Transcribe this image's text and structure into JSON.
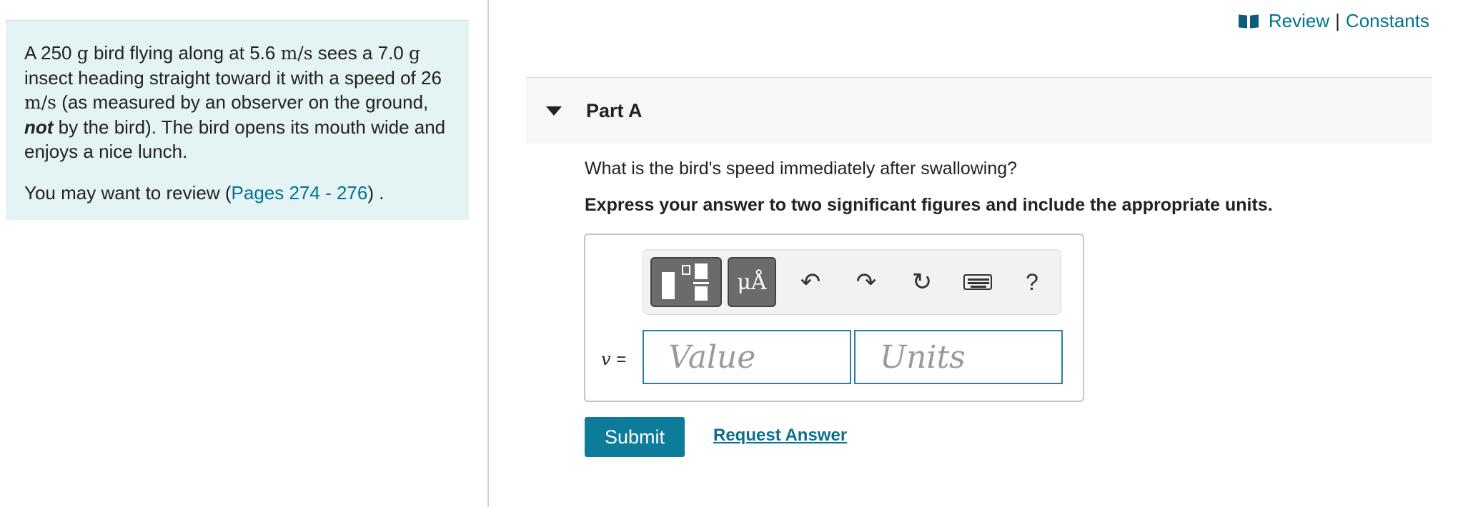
{
  "problem": {
    "p1_parts": [
      "A 250 ",
      "g",
      " bird flying along at 5.6 ",
      "m/s",
      " sees a 7.0 ",
      "g",
      " insect heading straight toward it with a speed of 26 ",
      "m/s",
      " (as measured by an observer on the ground, ",
      "not",
      " by the bird). The bird opens its mouth wide and enjoys a nice lunch."
    ],
    "review_prefix": "You may want to review (",
    "review_link": "Pages 274 - 276",
    "review_suffix": ") ."
  },
  "header": {
    "review_label": "Review",
    "separator": "|",
    "constants_label": "Constants"
  },
  "part": {
    "title": "Part A",
    "question": "What is the bird's speed immediately after swallowing?",
    "instruction": "Express your answer to two significant figures and include the appropriate units."
  },
  "toolbar": {
    "templates_icon": "templates-icon",
    "units_symbol_label": "μÅ",
    "undo_icon": "↶",
    "redo_icon": "↷",
    "reset_icon": "↻",
    "keyboard_icon": "keyboard-icon",
    "help_label": "?"
  },
  "answer": {
    "variable": "v",
    "equals": "=",
    "value_placeholder": "Value",
    "units_placeholder": "Units"
  },
  "actions": {
    "submit_label": "Submit",
    "request_answer_label": "Request Answer"
  },
  "colors": {
    "accent": "#0d7c9a",
    "panel_bg": "#e4f3f4",
    "link": "#00728f"
  }
}
